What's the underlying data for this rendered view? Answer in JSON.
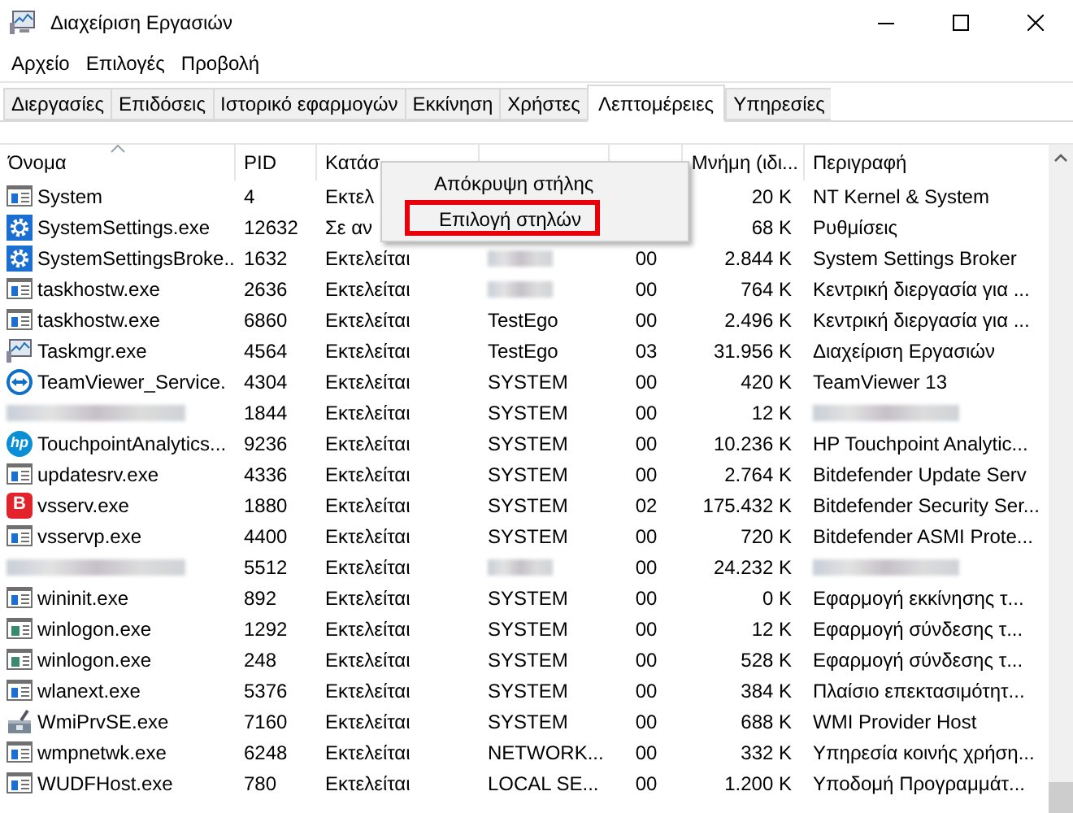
{
  "window": {
    "title": "Διαχείριση Εργασιών"
  },
  "menu": [
    "Αρχείο",
    "Επιλογές",
    "Προβολή"
  ],
  "tabs": [
    {
      "label": "Διεργασίες",
      "selected": false
    },
    {
      "label": "Επιδόσεις",
      "selected": false
    },
    {
      "label": "Ιστορικό εφαρμογών",
      "selected": false
    },
    {
      "label": "Εκκίνηση",
      "selected": false
    },
    {
      "label": "Χρήστες",
      "selected": false
    },
    {
      "label": "Λεπτομέρειες",
      "selected": true
    },
    {
      "label": "Υπηρεσίες",
      "selected": false
    }
  ],
  "table": {
    "columns": [
      {
        "label": "Όνομα",
        "sorted": true
      },
      {
        "label": "PID",
        "sorted": false
      },
      {
        "label": "Κατάσ",
        "sorted": false
      },
      {
        "sorted": false
      },
      {
        "sorted": false
      },
      {
        "label": "Μνήμη (ιδι...",
        "sorted": false
      },
      {
        "label": "Περιγραφή",
        "sorted": false
      }
    ],
    "rows": [
      {
        "kind": "window",
        "name": "System",
        "pid": "4",
        "status": "Εκτελ",
        "memory": "20 K",
        "description": "NT Kernel & System"
      },
      {
        "kind": "gear",
        "name": "SystemSettings.exe",
        "pid": "12632",
        "status": "Σε αν",
        "memory": "68 K",
        "description": "Ρυθμίσεις"
      },
      {
        "kind": "gear",
        "name": "SystemSettingsBroke...",
        "pid": "1632",
        "status": "Εκτελείται",
        "cpu": "00",
        "memory": "2.844 K",
        "description": "System Settings Broker",
        "user_blurred": true
      },
      {
        "kind": "window",
        "name": "taskhostw.exe",
        "pid": "2636",
        "status": "Εκτελείται",
        "cpu": "00",
        "memory": "764 K",
        "description": "Κεντρική διεργασία για ...",
        "user_blurred": true
      },
      {
        "kind": "window",
        "name": "taskhostw.exe",
        "pid": "6860",
        "status": "Εκτελείται",
        "user": "TestEgo",
        "cpu": "00",
        "memory": "2.496 K",
        "description": "Κεντρική διεργασία για ..."
      },
      {
        "kind": "monitor",
        "name": "Taskmgr.exe",
        "pid": "4564",
        "status": "Εκτελείται",
        "user": "TestEgo",
        "cpu": "03",
        "memory": "31.956 K",
        "description": "Διαχείριση Εργασιών"
      },
      {
        "kind": "arrows",
        "name": "TeamViewer_Service.",
        "pid": "4304",
        "status": "Εκτελείται",
        "user": "SYSTEM",
        "cpu": "00",
        "memory": "420 K",
        "description": "TeamViewer 13"
      },
      {
        "kind": "none",
        "pid": "1844",
        "status": "Εκτελείται",
        "user": "SYSTEM",
        "cpu": "00",
        "memory": "12 K",
        "name_blurred": true,
        "description_blurred": true
      },
      {
        "kind": "round",
        "badge": "hp",
        "name": "TouchpointAnalytics...",
        "pid": "9236",
        "status": "Εκτελείται",
        "user": "SYSTEM",
        "cpu": "00",
        "memory": "10.236 K",
        "description": "HP Touchpoint Analytic..."
      },
      {
        "kind": "window",
        "name": "updatesrv.exe",
        "pid": "4336",
        "status": "Εκτελείται",
        "user": "SYSTEM",
        "cpu": "00",
        "memory": "2.764 K",
        "description": "Bitdefender Update Serv"
      },
      {
        "kind": "square",
        "badge": "B",
        "name": "vsserv.exe",
        "pid": "1880",
        "status": "Εκτελείται",
        "user": "SYSTEM",
        "cpu": "02",
        "memory": "175.432 K",
        "description": "Bitdefender Security Ser..."
      },
      {
        "kind": "window",
        "name": "vsservp.exe",
        "pid": "4400",
        "status": "Εκτελείται",
        "user": "SYSTEM",
        "cpu": "00",
        "memory": "720 K",
        "description": "Bitdefender ASMI Prote..."
      },
      {
        "kind": "none",
        "pid": "5512",
        "status": "Εκτελείται",
        "cpu": "00",
        "memory": "24.232 K",
        "name_blurred": true,
        "user_blurred": true,
        "description_blurred": true
      },
      {
        "kind": "window",
        "name": "wininit.exe",
        "pid": "892",
        "status": "Εκτελείται",
        "user": "SYSTEM",
        "cpu": "00",
        "memory": "0 K",
        "description": "Εφαρμογή εκκίνησης τ..."
      },
      {
        "kind": "window-green",
        "name": "winlogon.exe",
        "pid": "1292",
        "status": "Εκτελείται",
        "user": "SYSTEM",
        "cpu": "00",
        "memory": "12 K",
        "description": "Εφαρμογή σύνδεσης τ..."
      },
      {
        "kind": "window-green",
        "name": "winlogon.exe",
        "pid": "248",
        "status": "Εκτελείται",
        "user": "SYSTEM",
        "cpu": "00",
        "memory": "528 K",
        "description": "Εφαρμογή σύνδεσης τ..."
      },
      {
        "kind": "window",
        "name": "wlanext.exe",
        "pid": "5376",
        "status": "Εκτελείται",
        "user": "SYSTEM",
        "cpu": "00",
        "memory": "384 K",
        "description": "Πλαίσιο επεκτασιμότητ..."
      },
      {
        "kind": "tools",
        "name": "WmiPrvSE.exe",
        "pid": "7160",
        "status": "Εκτελείται",
        "user": "SYSTEM",
        "cpu": "00",
        "memory": "688 K",
        "description": "WMI Provider Host"
      },
      {
        "kind": "window",
        "name": "wmpnetwk.exe",
        "pid": "6248",
        "status": "Εκτελείται",
        "user": "NETWORK...",
        "cpu": "00",
        "memory": "332 K",
        "description": "Υπηρεσία κοινής χρήση..."
      },
      {
        "kind": "window",
        "name": "WUDFHost.exe",
        "pid": "780",
        "status": "Εκτελείται",
        "user": "LOCAL SE...",
        "cpu": "00",
        "memory": "1.200 K",
        "description": "Υποδομή Προγραμμάτ..."
      }
    ]
  },
  "context_menu": {
    "items": [
      {
        "label": "Απόκρυψη στήλης",
        "highlighted": false
      },
      {
        "label": "Επιλογή στηλών",
        "highlighted": true
      }
    ]
  }
}
